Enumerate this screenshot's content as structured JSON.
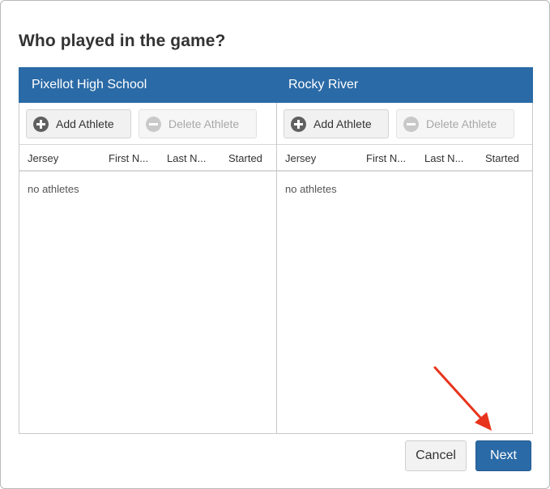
{
  "dialog": {
    "title": "Who played in the game?"
  },
  "teams": [
    {
      "name": "Pixellot High School",
      "add_label": "Add Athlete",
      "delete_label": "Delete Athlete",
      "columns": [
        "Jersey",
        "First N...",
        "Last N...",
        "Started"
      ],
      "empty_text": "no athletes"
    },
    {
      "name": "Rocky River",
      "add_label": "Add Athlete",
      "delete_label": "Delete Athlete",
      "columns": [
        "Jersey",
        "First N...",
        "Last N...",
        "Started"
      ],
      "empty_text": "no athletes"
    }
  ],
  "footer": {
    "cancel_label": "Cancel",
    "next_label": "Next"
  },
  "colors": {
    "header_blue": "#2a6aa6",
    "annotation_arrow": "#e8341c"
  }
}
